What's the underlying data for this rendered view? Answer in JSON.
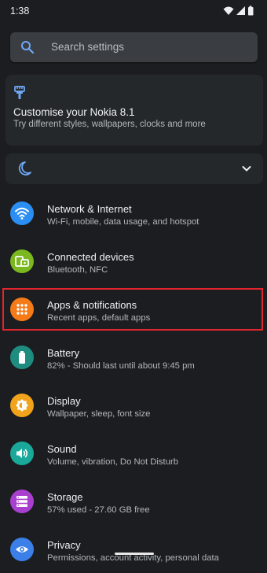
{
  "status_bar": {
    "time": "1:38",
    "icons": [
      "wifi-icon",
      "cellular-signal-icon",
      "battery-icon"
    ]
  },
  "search": {
    "placeholder": "Search settings"
  },
  "suggestion_card": {
    "title": "Customise your Nokia 8.1",
    "subtitle": "Try different styles, wallpapers, clocks and more",
    "icon": "paintbrush-icon"
  },
  "conditional_row": {
    "icon": "moon-icon",
    "expand_icon": "chevron-down-icon"
  },
  "items": [
    {
      "title": "Network & Internet",
      "subtitle": "Wi-Fi, mobile, data usage, and hotspot",
      "icon": "wifi-icon",
      "color": "#2b8ef3"
    },
    {
      "title": "Connected devices",
      "subtitle": "Bluetooth, NFC",
      "icon": "devices-icon",
      "color": "#7bb820"
    },
    {
      "title": "Apps & notifications",
      "subtitle": "Recent apps, default apps",
      "icon": "apps-grid-icon",
      "color": "#f57a18"
    },
    {
      "title": "Battery",
      "subtitle": "82% - Should last until about 9:45 pm",
      "icon": "battery-icon",
      "color": "#1f8c80"
    },
    {
      "title": "Display",
      "subtitle": "Wallpaper, sleep, font size",
      "icon": "brightness-icon",
      "color": "#f2a31c"
    },
    {
      "title": "Sound",
      "subtitle": "Volume, vibration, Do Not Disturb",
      "icon": "volume-icon",
      "color": "#19a89a"
    },
    {
      "title": "Storage",
      "subtitle": "57% used - 27.60 GB free",
      "icon": "storage-icon",
      "color": "#a93fcf"
    },
    {
      "title": "Privacy",
      "subtitle": "Permissions, account activity, personal data",
      "icon": "eye-icon",
      "color": "#3b7fe8"
    }
  ],
  "colors": {
    "background": "#1b1d20",
    "highlight": "#e3262d"
  }
}
